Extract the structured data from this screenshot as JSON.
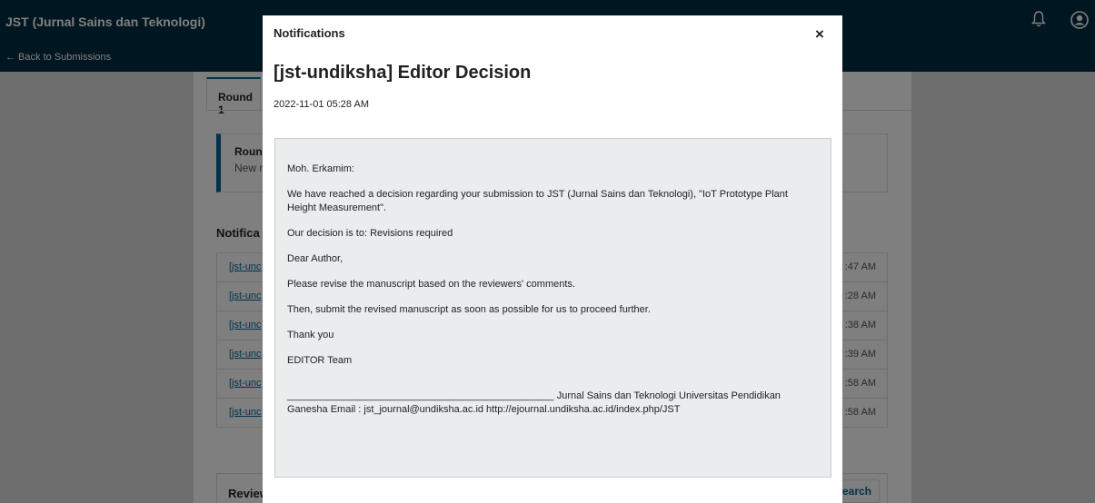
{
  "topbar": {
    "site_title": "JST (Jurnal Sains dan Teknologi)",
    "back_label": "← Back to Submissions"
  },
  "page": {
    "round_tab": "Round 1",
    "notice_title": "Roun",
    "notice_text": "New r",
    "notifications_heading": "Notifica",
    "notification_rows": [
      {
        "link": "[jst-unc",
        "time": ":47 AM"
      },
      {
        "link": "[jst-unc",
        "time": ":28 AM"
      },
      {
        "link": "[jst-unc",
        "time": ":38 AM"
      },
      {
        "link": "[jst-unc",
        "time": ":39 AM"
      },
      {
        "link": "[jst-unc",
        "time": ":58 AM"
      },
      {
        "link": "[jst-unc",
        "time": ":58 AM"
      }
    ],
    "attachments_title": "Reviewer's Attachments",
    "search_label": "Search"
  },
  "modal": {
    "header_title": "Notifications",
    "close_label": "×",
    "subject": "[jst-undiksha] Editor Decision",
    "date": "2022-11-01 05:28 AM",
    "body": {
      "greeting": "Moh. Erkamim:",
      "p1": "We have reached a decision regarding your submission to JST (Jurnal Sains dan Teknologi), \"IoT Prototype Plant Height Measurement\".",
      "p2": "Our decision is to: Revisions required",
      "p3": "Dear Author,",
      "p4": "Please revise the manuscript based on the reviewers' comments.",
      "p5": "Then, submit the revised manuscript as soon as possible for us to proceed further.",
      "p6": "Thank you",
      "p7": "EDITOR Team",
      "signature": "________________________________________________ Jurnal Sains dan Teknologi Universitas Pendidikan Ganesha Email : jst_journal@undiksha.ac.id http://ejournal.undiksha.ac.id/index.php/JST"
    }
  }
}
